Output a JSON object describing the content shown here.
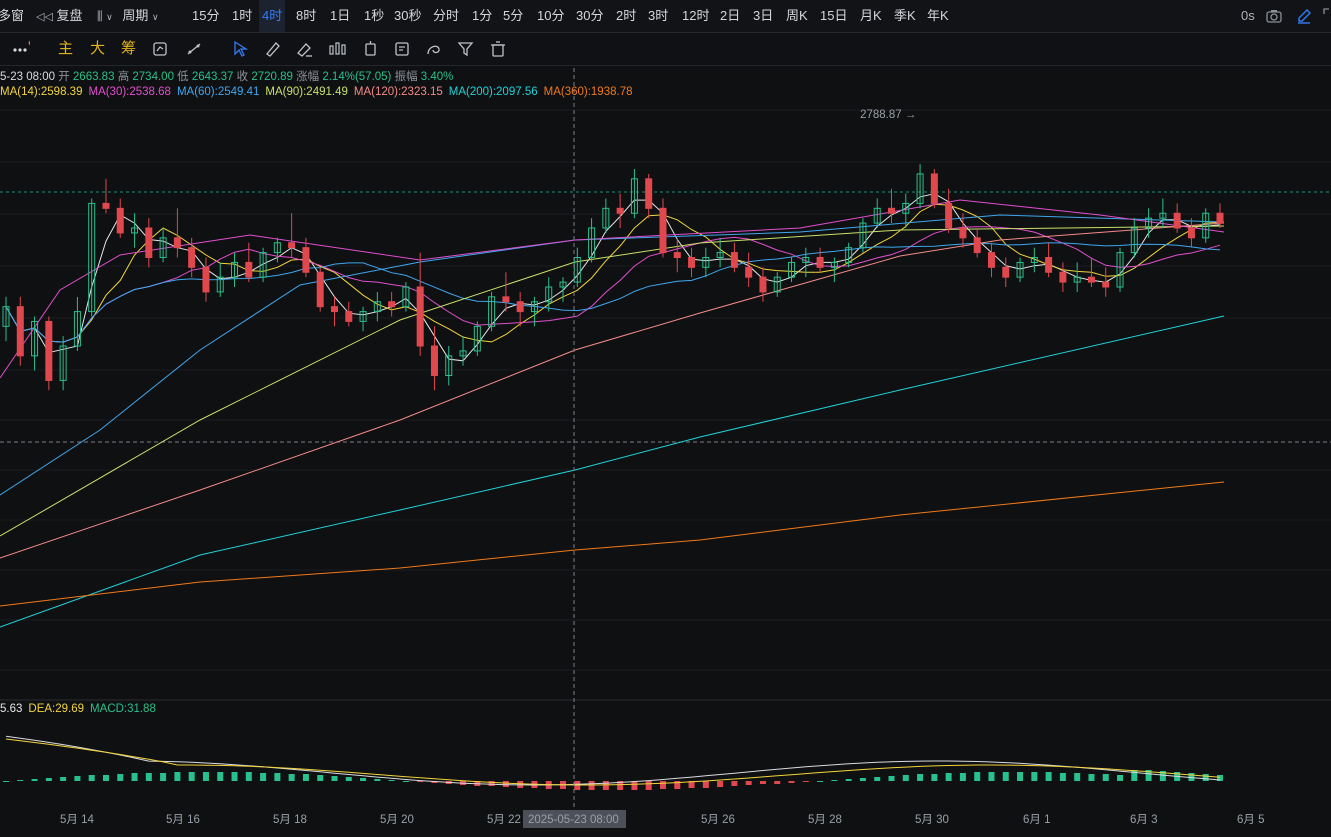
{
  "toolbar": {
    "left_items": [
      {
        "label": "多窗"
      },
      {
        "label": "复盘"
      },
      {
        "label": "周期"
      }
    ],
    "timeframes": [
      "15分",
      "1时",
      "4时",
      "8时",
      "1日",
      "1秒",
      "30秒",
      "分时",
      "1分",
      "5分",
      "10分",
      "30分",
      "2时",
      "3时",
      "12时",
      "2日",
      "3日",
      "周K",
      "15日",
      "月K",
      "季K",
      "年K"
    ],
    "active_timeframe": "4时",
    "right_text": "0s",
    "icons": [
      "camera-icon",
      "pen-icon",
      "expand-icon"
    ]
  },
  "drawbar": {
    "indicators": [
      "主",
      "大",
      "筹"
    ],
    "tools": [
      "more-icon",
      "compare-icon",
      "ruler-icon",
      "select-icon",
      "brush-icon",
      "measure-icon",
      "candles-icon",
      "clock-tool-icon",
      "note-icon",
      "swirl-icon",
      "filter-icon",
      "trash-icon"
    ]
  },
  "info": {
    "date": "5-23 08:00",
    "open_label": "开",
    "open": "2663.83",
    "high_label": "高",
    "high": "2734.00",
    "low_label": "低",
    "low": "2643.37",
    "close_label": "收",
    "close": "2720.89",
    "change_label": "涨幅",
    "change": "2.14%(57.05)",
    "amp_label": "振幅",
    "amp": "3.40%"
  },
  "ma": [
    {
      "label": "MA(14):2598.39",
      "color": "#f2d53c"
    },
    {
      "label": "MA(30):2538.68",
      "color": "#e24fcf"
    },
    {
      "label": "MA(60):2549.41",
      "color": "#3fa7ef"
    },
    {
      "label": "MA(90):2491.49",
      "color": "#c8e06a"
    },
    {
      "label": "MA(120):2323.15",
      "color": "#f58a8a"
    },
    {
      "label": "MA(200):2097.56",
      "color": "#1fd3d8"
    },
    {
      "label": "MA(360):1938.78",
      "color": "#f07a1a"
    }
  ],
  "macd": [
    {
      "label": "5.63",
      "color": "#e6e6e6"
    },
    {
      "label": "DEA:29.69",
      "color": "#f2d53c"
    },
    {
      "label": "MACD:31.88",
      "color": "#28c08b"
    }
  ],
  "crosshair_label": "2025-05-23 08:00",
  "max_label": "2788.87",
  "chart_data": {
    "type": "candlestick",
    "x_ticks": [
      "5月 14",
      "5月 16",
      "5月 18",
      "5月 20",
      "5月 22",
      "5月 26",
      "5月 28",
      "5月 30",
      "6月 1",
      "6月 3",
      "6月 5"
    ],
    "y_range": [
      1700,
      2900
    ],
    "colors": {
      "up": "#28c08b",
      "down": "#e0484e"
    },
    "candles": [
      [
        2460,
        2520,
        2430,
        2500
      ],
      [
        2500,
        2520,
        2380,
        2400
      ],
      [
        2400,
        2480,
        2370,
        2470
      ],
      [
        2470,
        2480,
        2330,
        2350
      ],
      [
        2350,
        2440,
        2330,
        2420
      ],
      [
        2420,
        2520,
        2410,
        2490
      ],
      [
        2490,
        2720,
        2480,
        2710
      ],
      [
        2710,
        2760,
        2690,
        2700
      ],
      [
        2700,
        2720,
        2640,
        2650
      ],
      [
        2650,
        2690,
        2620,
        2660
      ],
      [
        2660,
        2680,
        2580,
        2600
      ],
      [
        2600,
        2660,
        2590,
        2640
      ],
      [
        2640,
        2700,
        2600,
        2620
      ],
      [
        2620,
        2640,
        2560,
        2580
      ],
      [
        2580,
        2600,
        2510,
        2530
      ],
      [
        2530,
        2590,
        2520,
        2560
      ],
      [
        2560,
        2610,
        2540,
        2590
      ],
      [
        2590,
        2630,
        2550,
        2560
      ],
      [
        2560,
        2620,
        2550,
        2610
      ],
      [
        2610,
        2640,
        2590,
        2630
      ],
      [
        2630,
        2690,
        2600,
        2620
      ],
      [
        2620,
        2640,
        2560,
        2570
      ],
      [
        2570,
        2580,
        2490,
        2500
      ],
      [
        2500,
        2520,
        2460,
        2490
      ],
      [
        2490,
        2510,
        2460,
        2470
      ],
      [
        2470,
        2500,
        2450,
        2490
      ],
      [
        2490,
        2530,
        2470,
        2510
      ],
      [
        2510,
        2530,
        2480,
        2500
      ],
      [
        2500,
        2550,
        2490,
        2540
      ],
      [
        2540,
        2610,
        2400,
        2420
      ],
      [
        2420,
        2460,
        2330,
        2360
      ],
      [
        2360,
        2420,
        2340,
        2400
      ],
      [
        2400,
        2440,
        2380,
        2410
      ],
      [
        2410,
        2470,
        2400,
        2460
      ],
      [
        2460,
        2530,
        2450,
        2520
      ],
      [
        2520,
        2570,
        2490,
        2510
      ],
      [
        2510,
        2530,
        2460,
        2490
      ],
      [
        2490,
        2520,
        2460,
        2510
      ],
      [
        2510,
        2560,
        2490,
        2540
      ],
      [
        2540,
        2560,
        2510,
        2550
      ],
      [
        2550,
        2620,
        2540,
        2600
      ],
      [
        2600,
        2680,
        2590,
        2660
      ],
      [
        2660,
        2720,
        2650,
        2700
      ],
      [
        2700,
        2730,
        2660,
        2690
      ],
      [
        2690,
        2780,
        2680,
        2760
      ],
      [
        2760,
        2770,
        2680,
        2700
      ],
      [
        2700,
        2720,
        2600,
        2610
      ],
      [
        2610,
        2640,
        2570,
        2600
      ],
      [
        2600,
        2620,
        2560,
        2580
      ],
      [
        2580,
        2620,
        2560,
        2600
      ],
      [
        2600,
        2640,
        2580,
        2610
      ],
      [
        2610,
        2630,
        2570,
        2580
      ],
      [
        2580,
        2610,
        2540,
        2560
      ],
      [
        2560,
        2580,
        2510,
        2530
      ],
      [
        2530,
        2570,
        2520,
        2560
      ],
      [
        2560,
        2600,
        2550,
        2590
      ],
      [
        2590,
        2620,
        2560,
        2600
      ],
      [
        2600,
        2620,
        2570,
        2580
      ],
      [
        2580,
        2600,
        2550,
        2590
      ],
      [
        2590,
        2630,
        2580,
        2620
      ],
      [
        2620,
        2680,
        2610,
        2670
      ],
      [
        2670,
        2720,
        2660,
        2700
      ],
      [
        2700,
        2740,
        2670,
        2690
      ],
      [
        2690,
        2730,
        2660,
        2710
      ],
      [
        2710,
        2790,
        2700,
        2770
      ],
      [
        2770,
        2780,
        2700,
        2710
      ],
      [
        2710,
        2740,
        2650,
        2660
      ],
      [
        2660,
        2690,
        2620,
        2640
      ],
      [
        2640,
        2660,
        2600,
        2610
      ],
      [
        2610,
        2630,
        2560,
        2580
      ],
      [
        2580,
        2600,
        2540,
        2560
      ],
      [
        2560,
        2600,
        2550,
        2590
      ],
      [
        2590,
        2620,
        2570,
        2600
      ],
      [
        2600,
        2630,
        2560,
        2570
      ],
      [
        2570,
        2590,
        2530,
        2550
      ],
      [
        2550,
        2590,
        2530,
        2560
      ],
      [
        2560,
        2600,
        2540,
        2550
      ],
      [
        2550,
        2580,
        2520,
        2540
      ],
      [
        2540,
        2620,
        2530,
        2610
      ],
      [
        2610,
        2680,
        2600,
        2660
      ],
      [
        2660,
        2700,
        2640,
        2680
      ],
      [
        2680,
        2720,
        2660,
        2690
      ],
      [
        2690,
        2710,
        2650,
        2660
      ],
      [
        2660,
        2680,
        2620,
        2640
      ],
      [
        2640,
        2700,
        2630,
        2690
      ],
      [
        2690,
        2710,
        2660,
        2670
      ]
    ]
  }
}
